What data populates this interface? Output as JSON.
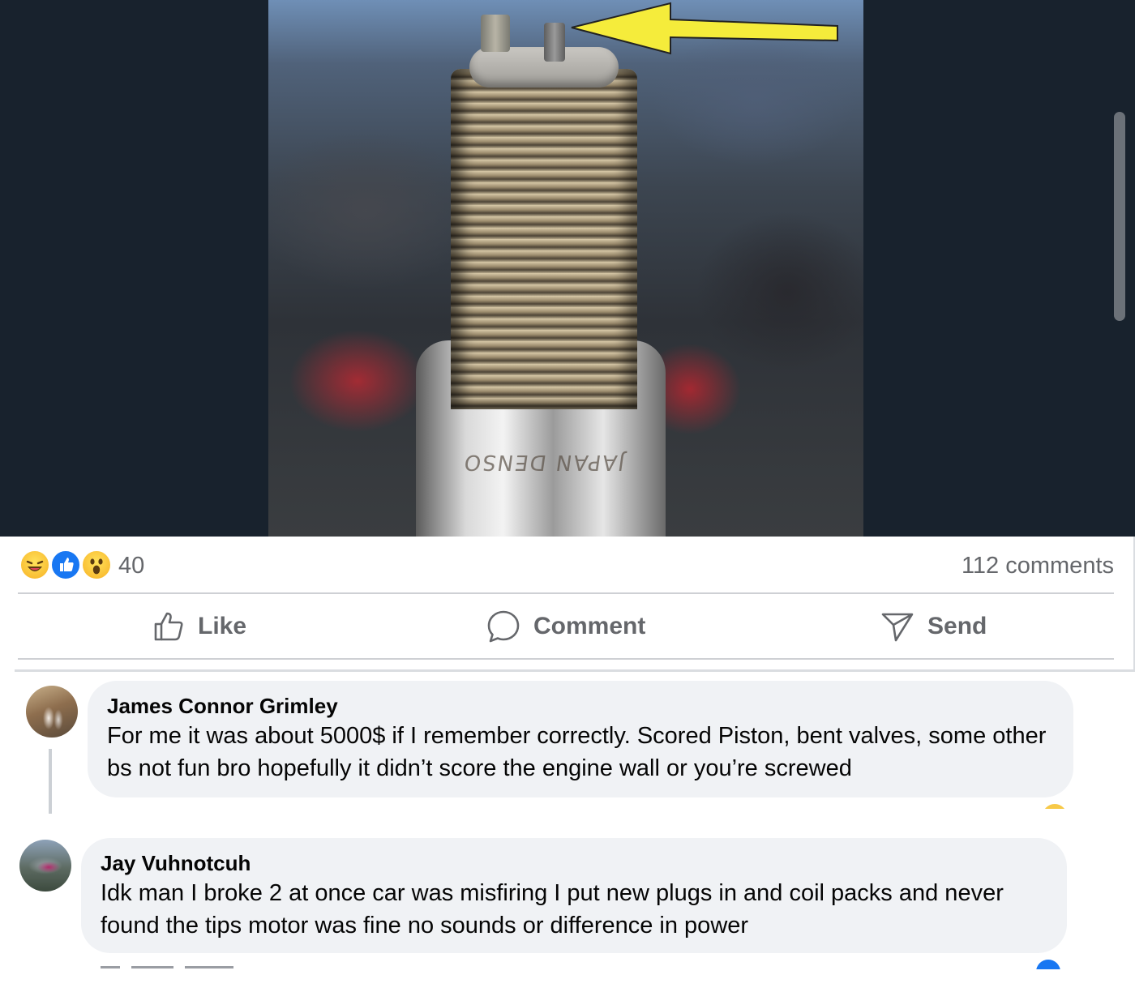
{
  "post": {
    "image_alt": "Spark plug close-up with arrow pointing at broken tip",
    "image_text": "JAPAN DENSO",
    "reaction_icons": [
      "haha-icon",
      "like-icon",
      "wow-icon"
    ],
    "reaction_count": "40",
    "comments_count": "112 comments"
  },
  "actions": {
    "like_label": "Like",
    "comment_label": "Comment",
    "send_label": "Send"
  },
  "comments": [
    {
      "author": "James Connor Grimley",
      "text": "For me it was about 5000$ if I remember correctly. Scored Piston, bent valves, some other bs not fun bro hopefully it didn’t score the engine wall or you’re screwed"
    },
    {
      "author": "Jay Vuhnotcuh",
      "text": "Idk man I broke 2 at once car was misfiring I put new plugs in and coil packs and never found the tips motor was fine no sounds or difference in power"
    }
  ],
  "colors": {
    "accent": "#1877f2",
    "secondary_text": "#65676b",
    "bubble": "#f0f2f5",
    "media_background": "#18222d",
    "arrow": "#f5ec3b"
  }
}
